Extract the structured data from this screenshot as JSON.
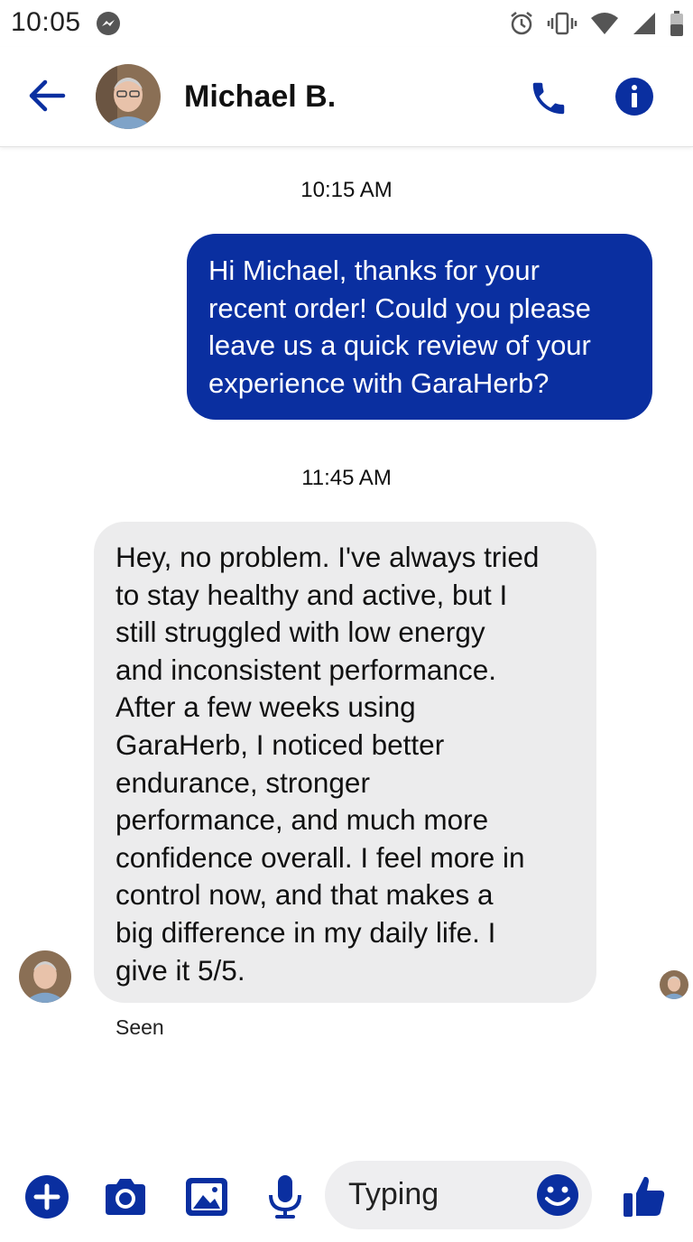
{
  "status_bar": {
    "time": "10:05"
  },
  "header": {
    "contact_name": "Michael B."
  },
  "conversation": {
    "messages": [
      {
        "timestamp": "10:15 AM",
        "direction": "outgoing",
        "lines": [
          "Hi Michael, thanks for your",
          "recent order! Could you please",
          "leave us a quick review of your",
          "experience with GaraHerb?"
        ]
      },
      {
        "timestamp": "11:45 AM",
        "direction": "incoming",
        "lines": [
          "Hey, no problem. I've always tried",
          "to stay healthy and active, but I",
          "still struggled with low energy",
          "and inconsistent performance.",
          "After a few weeks using",
          "GaraHerb, I noticed better",
          "endurance, stronger",
          "performance, and much more",
          "confidence overall. I feel more in",
          "control now, and that makes a",
          "big difference in my daily life. I",
          "give it 5/5."
        ]
      }
    ],
    "read_receipt": "Seen"
  },
  "composer": {
    "input_value": "Typing"
  },
  "colors": {
    "accent": "#0a2fa0",
    "incoming_bubble": "#ececed"
  },
  "icons": [
    "messenger-icon",
    "alarm-icon",
    "vibrate-icon",
    "wifi-icon",
    "signal-icon",
    "battery-icon",
    "back-arrow-icon",
    "phone-icon",
    "info-icon",
    "plus-icon",
    "camera-icon",
    "gallery-icon",
    "microphone-icon",
    "emoji-icon",
    "thumbs-up-icon"
  ]
}
